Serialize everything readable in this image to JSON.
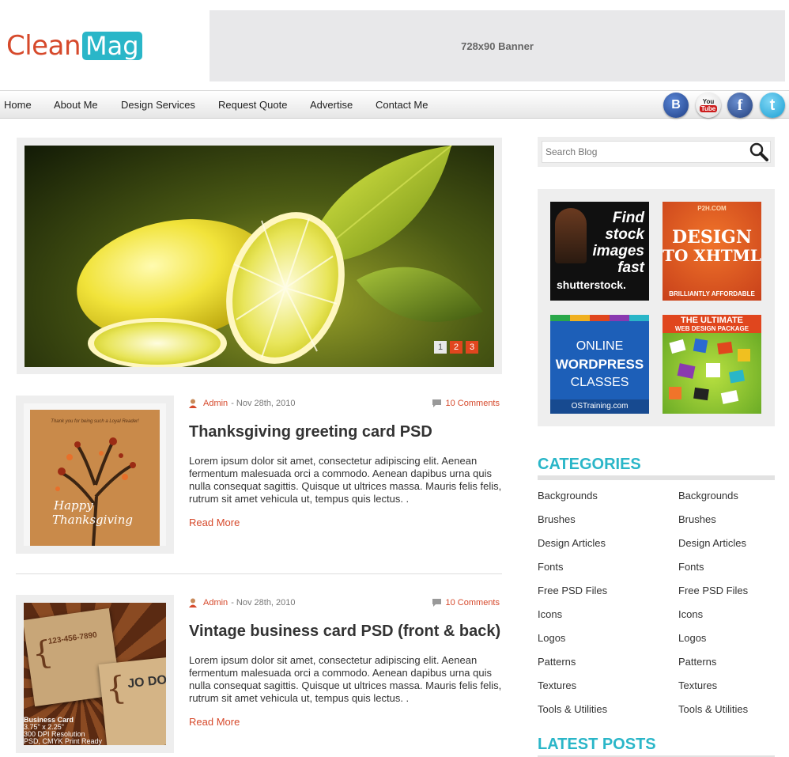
{
  "logo": {
    "part1": "Clean",
    "part2": "Mag"
  },
  "banner": {
    "label": "728x90 Banner"
  },
  "nav": {
    "items": [
      "Home",
      "About Me",
      "Design Services",
      "Request Quote",
      "Advertise",
      "Contact Me"
    ]
  },
  "social": [
    {
      "name": "blogger",
      "glyph": "B",
      "color": "#2f5aa8"
    },
    {
      "name": "youtube",
      "glyph": "You Tube",
      "color": "#cc1b1b"
    },
    {
      "name": "facebook",
      "glyph": "f",
      "color": "#3b5e9e"
    },
    {
      "name": "twitter",
      "glyph": "t",
      "color": "#29b6e8"
    }
  ],
  "slider": {
    "pages": [
      "1",
      "2",
      "3"
    ],
    "active_page": 1
  },
  "posts": [
    {
      "author": "Admin",
      "date": "- Nov 28th, 2010",
      "comments": "10 Comments",
      "title": "Thanksgiving greeting card PSD",
      "excerpt": "Lorem ipsum dolor sit amet, consectetur adipiscing elit. Aenean fermentum malesuada orci a commodo. Aenean dapibus urna quis nulla consequat sagittis. Quisque ut ultrices massa. Mauris felis felis, rutrum sit amet vehicula ut, tempus quis lectus. .",
      "read_more": "Read More",
      "thumb_text": {
        "top": "Thank you for being such a Loyal Reader!",
        "line1": "Happy",
        "line2": "Thanksgiving"
      }
    },
    {
      "author": "Admin",
      "date": "- Nov 28th, 2010",
      "comments": "10 Comments",
      "title": "Vintage business card PSD (front & back)",
      "excerpt": "Lorem ipsum dolor sit amet, consectetur adipiscing elit. Aenean fermentum malesuada orci a commodo. Aenean dapibus urna quis nulla consequat sagittis. Quisque ut ultrices massa. Mauris felis felis, rutrum sit amet vehicula ut, tempus quis lectus. .",
      "read_more": "Read More",
      "thumb_text": {
        "phone": "123-456-7890",
        "label": "Business Card",
        "size": "3.75\" x 2.25\"",
        "res": "300 DPI Resolution",
        "mode": "PSD, CMYK Print Ready",
        "back": "JO DO"
      }
    }
  ],
  "search": {
    "placeholder": "Search Blog"
  },
  "ads": [
    {
      "lines": [
        "Find",
        "stock",
        "images",
        "fast"
      ],
      "brand": "shutterstock."
    },
    {
      "top": "P2H.COM",
      "lines": [
        "DESIGN",
        "TO XHTML"
      ],
      "bottom": "BRILLIANTLY AFFORDABLE"
    },
    {
      "lines": [
        "ONLINE",
        "WORDPRESS",
        "CLASSES"
      ],
      "bottom": "OSTraining.com"
    },
    {
      "lines": [
        "THE ULTIMATE",
        "WEB DESIGN PACKAGE"
      ]
    }
  ],
  "categories": {
    "title": "CATEGORIES",
    "col1": [
      "Backgrounds",
      "Brushes",
      "Design Articles",
      "Fonts",
      "Free PSD Files",
      "Icons",
      "Logos",
      "Patterns",
      "Textures",
      "Tools & Utilities"
    ],
    "col2": [
      "Backgrounds",
      "Brushes",
      "Design Articles",
      "Fonts",
      "Free PSD Files",
      "Icons",
      "Logos",
      "Patterns",
      "Textures",
      "Tools & Utilities"
    ]
  },
  "latest_posts": {
    "title": "LATEST POSTS"
  },
  "colors": {
    "accent": "#d6492b",
    "teal": "#2ab6c8"
  }
}
